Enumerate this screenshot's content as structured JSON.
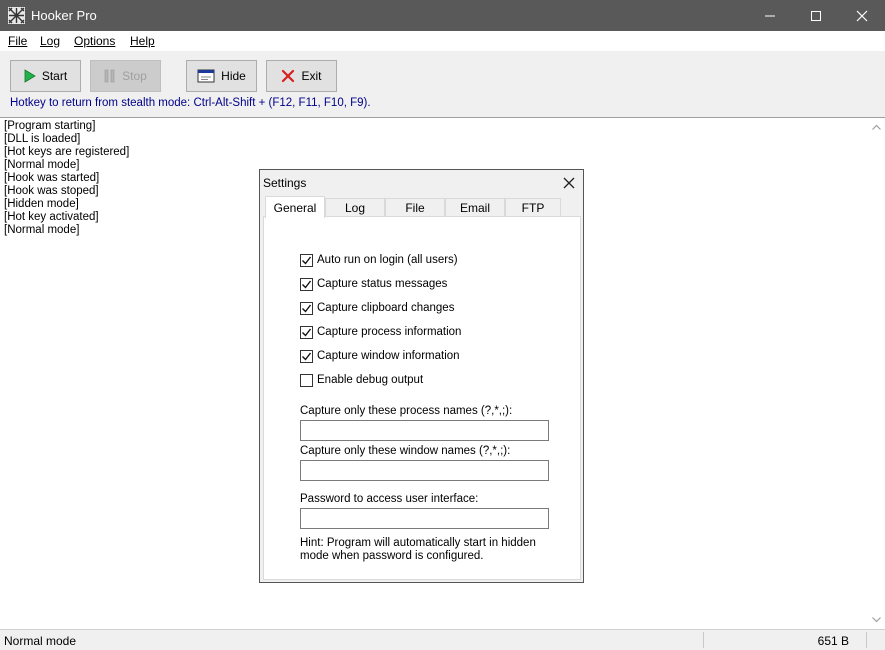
{
  "window": {
    "title": "Hooker Pro",
    "title_bar_color": "#595959"
  },
  "menubar": {
    "items": [
      {
        "label": "File"
      },
      {
        "label": "Log"
      },
      {
        "label": "Options"
      },
      {
        "label": "Help"
      }
    ]
  },
  "toolbar": {
    "start_label": "Start",
    "stop_label": "Stop",
    "hide_label": "Hide",
    "exit_label": "Exit",
    "hotkey_text": "Hotkey to return from stealth mode: Ctrl-Alt-Shift + (F12, F11, F10, F9)."
  },
  "log": {
    "lines": [
      "[Program starting]",
      "[DLL is loaded]",
      "[Hot keys are registered]",
      "[Normal mode]",
      "[Hook was started]",
      "[Hook was stoped]",
      "[Hidden mode]",
      "[Hot key activated]",
      "[Normal mode]"
    ]
  },
  "statusbar": {
    "mode": "Normal mode",
    "size": "651 B"
  },
  "settings": {
    "title": "Settings",
    "tabs": [
      {
        "label": "General",
        "active": true
      },
      {
        "label": "Log",
        "active": false
      },
      {
        "label": "File",
        "active": false
      },
      {
        "label": "Email",
        "active": false
      },
      {
        "label": "FTP",
        "active": false
      }
    ],
    "checkboxes": [
      {
        "label": "Auto run on login (all users)",
        "checked": true
      },
      {
        "label": "Capture status messages",
        "checked": true
      },
      {
        "label": "Capture clipboard changes",
        "checked": true
      },
      {
        "label": "Capture process information",
        "checked": true
      },
      {
        "label": "Capture window information",
        "checked": true
      },
      {
        "label": "Enable debug output",
        "checked": false
      }
    ],
    "process_names_label": "Capture only these process names (?,*,;):",
    "process_names_value": "",
    "window_names_label": "Capture only these window names (?,*,;):",
    "window_names_value": "",
    "password_label": "Password to access user interface:",
    "password_value": "",
    "hint": "Hint: Program will automatically start in hidden mode when password is configured."
  },
  "icons": {
    "start": "play-icon",
    "stop": "pause-icon",
    "hide": "window-hide-icon",
    "exit": "x-icon"
  },
  "colors": {
    "play_green": "#22b14c",
    "exit_red": "#d62020",
    "hotkey_text": "#00008b"
  }
}
